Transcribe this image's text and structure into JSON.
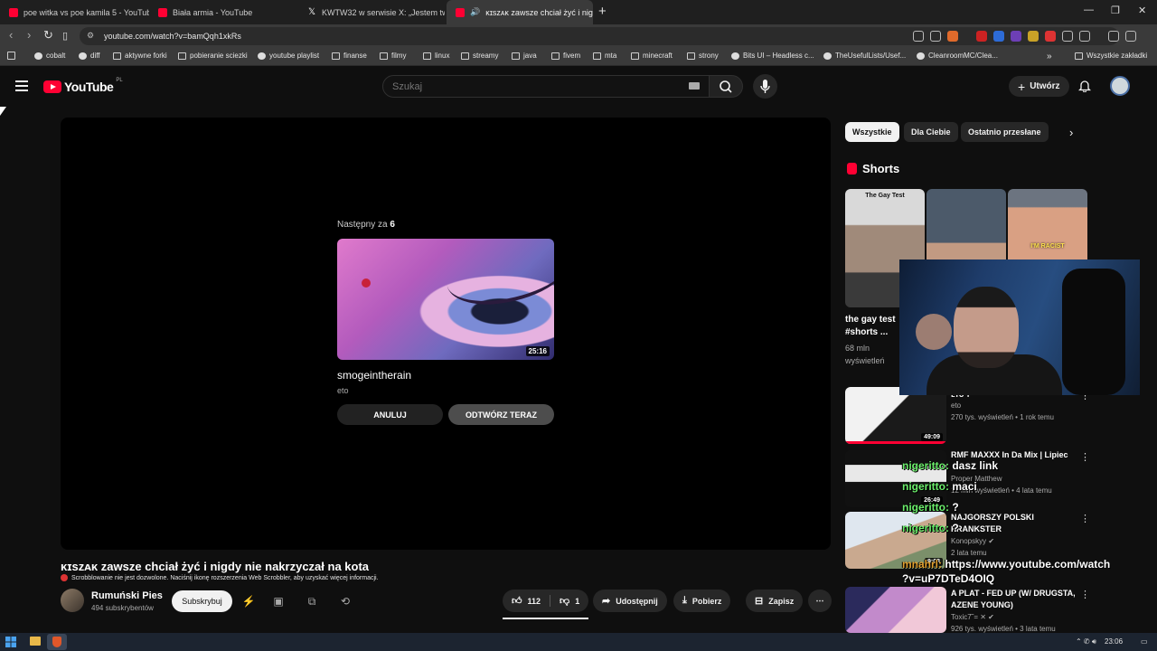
{
  "browser": {
    "tabs": [
      {
        "title": "poe witka vs poe kamila 5 - YouTube",
        "icon": "youtube"
      },
      {
        "title": "Biała armia - YouTube",
        "icon": "youtube"
      },
      {
        "title": "KWTW32 w serwisie X: „Jestem twór",
        "icon": "x"
      },
      {
        "title": "ᴋɪѕᴢᴀᴋ zawsze chciał żyć i nigd",
        "icon": "youtube",
        "audio": true
      }
    ],
    "new_tab": "+",
    "window_controls": [
      "—",
      "❐",
      "✕"
    ],
    "url": "youtube.com/watch?v=bamQqh1xkRs"
  },
  "bookmarks": [
    {
      "label": "cobalt"
    },
    {
      "label": "diff"
    },
    {
      "label": "aktywne forki"
    },
    {
      "label": "pobieranie sciezki"
    },
    {
      "label": "youtube playlist"
    },
    {
      "label": "finanse"
    },
    {
      "label": "filmy"
    },
    {
      "label": "linux"
    },
    {
      "label": "streamy"
    },
    {
      "label": "java"
    },
    {
      "label": "fivem"
    },
    {
      "label": "mta"
    },
    {
      "label": "minecraft"
    },
    {
      "label": "strony"
    },
    {
      "label": "Bits UI – Headless c..."
    },
    {
      "label": "TheUsefulLists/Usef..."
    },
    {
      "label": "CleanroomMC/Clea..."
    },
    {
      "label": "Wszystkie zakładki"
    }
  ],
  "youtube": {
    "logo_text": "YouTube",
    "country": "PL",
    "search_placeholder": "Szukaj",
    "create_label": "Utwórz"
  },
  "player": {
    "next_label": "Następny za",
    "next_countdown": "6",
    "next_title": "smogeintherain",
    "next_channel": "eto",
    "next_duration": "25:16",
    "cancel_label": "ANULUJ",
    "play_now_label": "ODTWÓRZ TERAZ"
  },
  "video": {
    "title_prefix": "ᴋɪѕᴢᴀᴋ",
    "title": "zawsze chciał żyć i nigdy nie nakrzyczał na kota",
    "scrobble_notice": "Scrobblowanie nie jest dozwolone. Naciśnij ikonę rozszerzenia Web Scrobbler, aby uzyskać więcej informacji.",
    "channel_name": "Rumuński Pies",
    "subscribers": "494 subskrybentów",
    "subscribe_label": "Subskrybuj",
    "likes": "112",
    "dislikes": "1",
    "share_label": "Udostępnij",
    "download_label": "Pobierz",
    "save_label": "Zapisz",
    "more_label": "⋯"
  },
  "sidebar": {
    "chips": [
      "Wszystkie",
      "Dla Ciebie",
      "Ostatnio przesłane"
    ],
    "shorts_heading": "Shorts",
    "shorts": [
      {
        "caption": "The Gay Test",
        "title": "the gay test #shorts ...",
        "views": "68 mln wyświetleń"
      },
      {
        "caption": "",
        "title": "",
        "views": ""
      },
      {
        "caption": "I'M RACIST",
        "title": "",
        "views": ""
      }
    ],
    "related": [
      {
        "title": "ᴇᴛᴏ ᴛ",
        "channel": "eto",
        "meta": "270 tys. wyświetleń • 1 rok temu",
        "duration": "49:09"
      },
      {
        "title": "RMF MAXXX In Da Mix | Lipiec",
        "channel": "Proper Matthew",
        "meta": "12 mln wyświetleń • 4 lata temu",
        "duration": "26:49"
      },
      {
        "title": "NAJGORSZY POLSKI PRANKSTER",
        "channel": "Konopskyy",
        "meta": "2 lata temu",
        "duration": "9:03"
      },
      {
        "title": "A PLAT - FED UP (W/ DRUGSTA, AZENE YOUNG)",
        "channel": "Toxic7˜= ✕",
        "meta": "926 tys. wyświetleń • 3 lata temu",
        "duration": ""
      }
    ]
  },
  "chat": [
    {
      "nick": "nigeritto:",
      "text": "dasz link"
    },
    {
      "nick": "nigeritto:",
      "text": "maci"
    },
    {
      "nick": "nigeritto:",
      "text": "?"
    },
    {
      "nick": "nigeritto:",
      "text": "?"
    },
    {
      "nick": "mnahrl:",
      "text": "https://www.youtube.com/watch"
    },
    {
      "nick": "",
      "text": "?v=uP7DTeD4OIQ"
    }
  ],
  "taskbar": {
    "time": "23:06"
  },
  "colors": {
    "background": "#0f0f0f",
    "accent_red": "#ff0033",
    "chat_nick": "#6cf06c"
  }
}
